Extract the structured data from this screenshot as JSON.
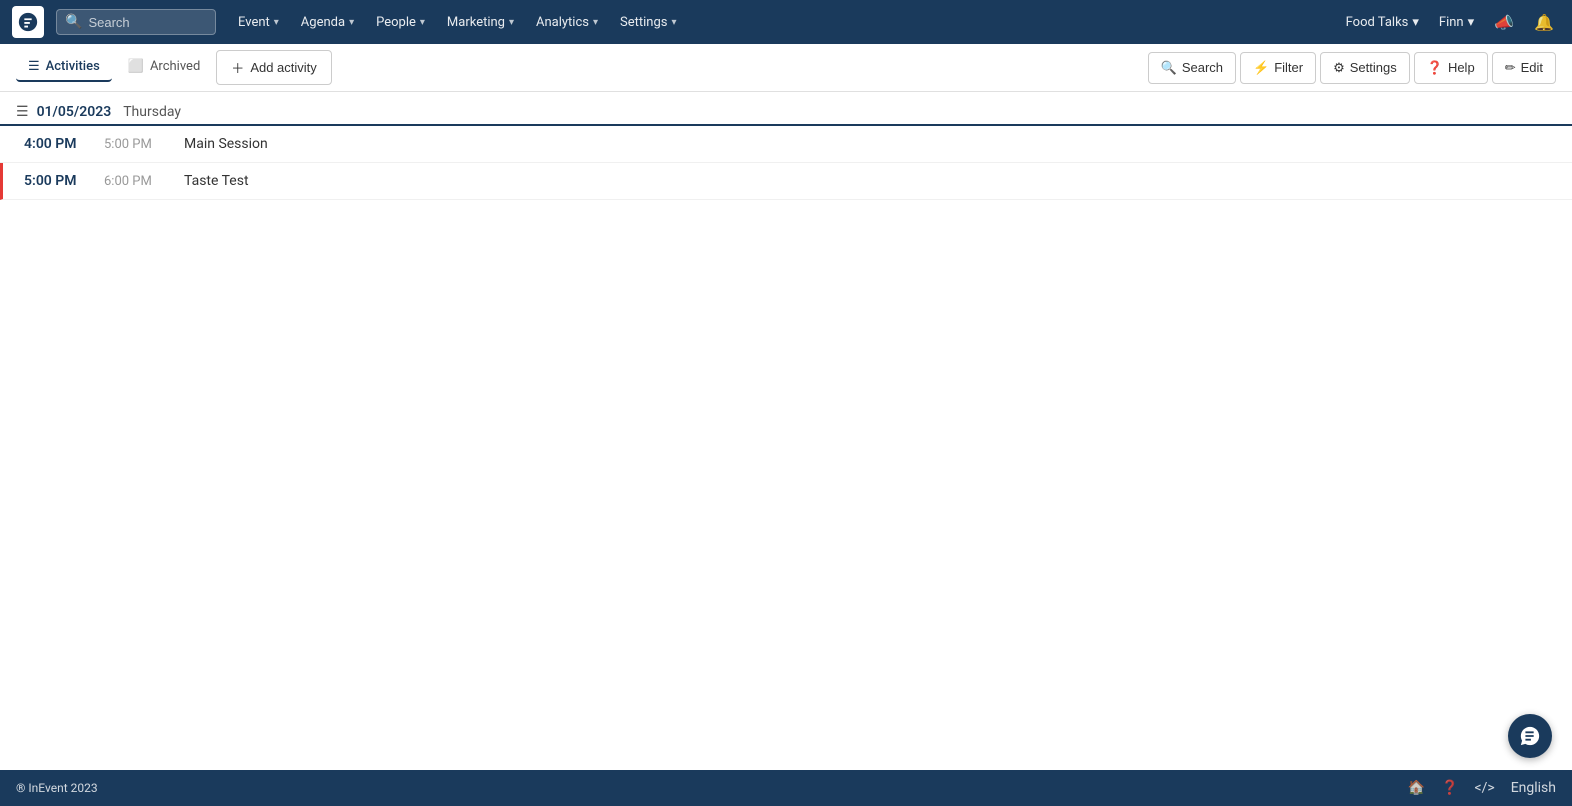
{
  "app": {
    "logo_alt": "InEvent logo"
  },
  "nav": {
    "search_placeholder": "Search",
    "items": [
      {
        "label": "Event",
        "has_dropdown": true
      },
      {
        "label": "Agenda",
        "has_dropdown": true
      },
      {
        "label": "People",
        "has_dropdown": true
      },
      {
        "label": "Marketing",
        "has_dropdown": true
      },
      {
        "label": "Analytics",
        "has_dropdown": true
      },
      {
        "label": "Settings",
        "has_dropdown": true
      }
    ],
    "event_name": "Food Talks",
    "user_name": "Finn",
    "megaphone_icon": "📣",
    "bell_icon": "🔔"
  },
  "toolbar": {
    "tabs": [
      {
        "label": "Activities",
        "icon": "☰",
        "active": true
      },
      {
        "label": "Archived",
        "icon": "⬜",
        "active": false
      }
    ],
    "add_button_label": "Add activity",
    "action_buttons": [
      {
        "label": "Search",
        "icon": "search"
      },
      {
        "label": "Filter",
        "icon": "filter"
      },
      {
        "label": "Settings",
        "icon": "settings"
      },
      {
        "label": "Help",
        "icon": "help"
      },
      {
        "label": "Edit",
        "icon": "edit"
      }
    ]
  },
  "agenda": {
    "date": "01/05/2023",
    "day": "Thursday",
    "activities": [
      {
        "start": "4:00 PM",
        "end": "5:00 PM",
        "name": "Main Session",
        "highlighted": false
      },
      {
        "start": "5:00 PM",
        "end": "6:00 PM",
        "name": "Taste Test",
        "highlighted": true
      }
    ]
  },
  "footer": {
    "copyright": "® InEvent 2023",
    "language": "English"
  }
}
